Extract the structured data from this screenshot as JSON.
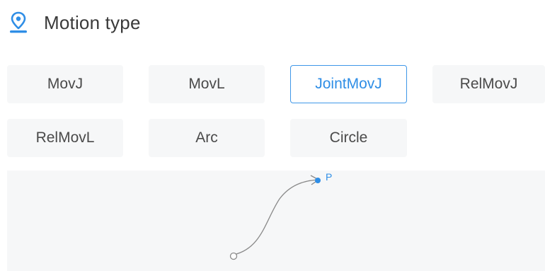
{
  "header": {
    "title": "Motion type",
    "icon": "location-pin-icon"
  },
  "accent_color": "#2f8ee6",
  "motion_buttons": [
    {
      "label": "MovJ",
      "selected": false
    },
    {
      "label": "MovL",
      "selected": false
    },
    {
      "label": "JointMovJ",
      "selected": true
    },
    {
      "label": "RelMovJ",
      "selected": false
    },
    {
      "label": "RelMovL",
      "selected": false
    },
    {
      "label": "Arc",
      "selected": false
    },
    {
      "label": "Circle",
      "selected": false
    }
  ],
  "diagram": {
    "point_label": "P"
  }
}
